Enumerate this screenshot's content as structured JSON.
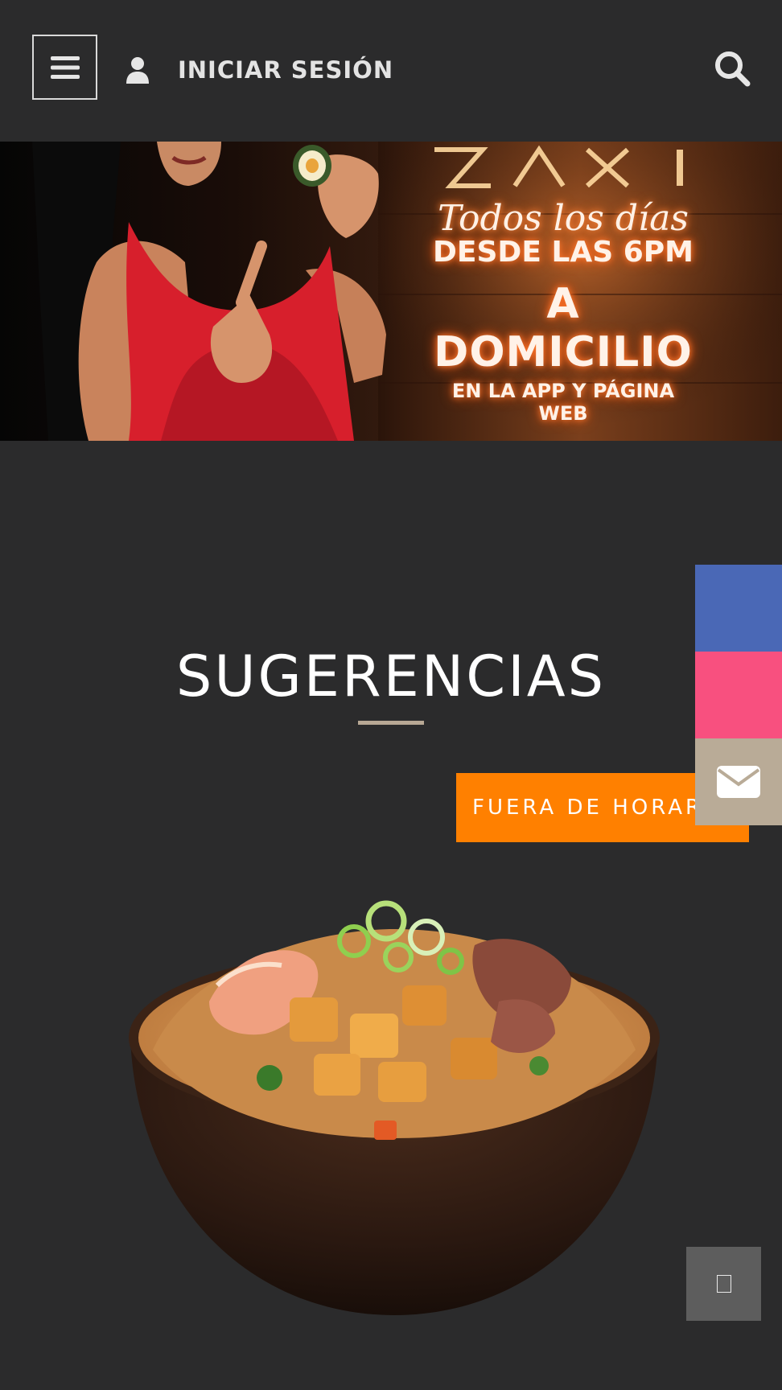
{
  "header": {
    "menu_icon": "hamburger-icon",
    "login_icon": "user-icon",
    "login_label": "INICIAR SESIÓN",
    "search_icon": "search-icon"
  },
  "banner": {
    "line1": "Todos los días",
    "line2": "DESDE LAS 6PM",
    "line3": "A DOMICILIO",
    "line4": "EN LA APP Y PÁGINA WEB"
  },
  "main": {
    "section_title": "SUGERENCIAS",
    "status_badge": "FUERA DE HORARIO"
  },
  "social": {
    "items": [
      {
        "name": "facebook-button",
        "color": "#4a68b6"
      },
      {
        "name": "instagram-button",
        "color": "#f8507f"
      },
      {
        "name": "email-button",
        "color": "#b9ab97",
        "icon": "envelope-icon"
      }
    ]
  },
  "colors": {
    "background": "#2b2b2c",
    "accent_orange": "#ff8000",
    "underline": "#b8a895"
  }
}
